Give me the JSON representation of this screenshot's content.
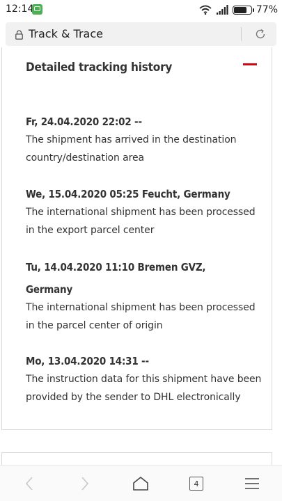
{
  "status_bar": {
    "time": "12:14",
    "battery": "77%",
    "battery_level": 0.77
  },
  "url_bar": {
    "title": "Track & Trace"
  },
  "tracking": {
    "title": "Detailed tracking history",
    "events": [
      {
        "header": "Fr, 24.04.2020 22:02 --",
        "description_lines": [
          "The shipment has arrived in the destination",
          "country/destination area"
        ]
      },
      {
        "header": "We, 15.04.2020 05:25 Feucht, Germany",
        "description_lines": [
          "The international shipment has been processed",
          "in the export parcel center"
        ]
      },
      {
        "header_lines": [
          "Tu, 14.04.2020 11:10 Bremen GVZ,",
          "Germany"
        ],
        "description_lines": [
          "The international shipment has been processed",
          "in the parcel center of origin"
        ]
      },
      {
        "header": "Mo, 13.04.2020 14:31 --",
        "description_lines": [
          "The instruction data for this shipment have been",
          "provided by the sender to DHL electronically"
        ]
      }
    ]
  },
  "nav": {
    "tab_count": "4"
  },
  "colors": {
    "accent": "#d40511",
    "text": "#333333"
  }
}
